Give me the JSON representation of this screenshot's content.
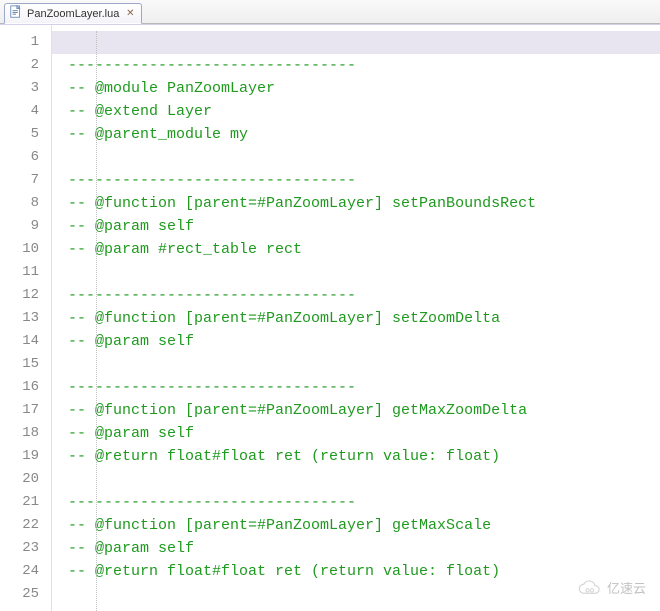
{
  "tab": {
    "filename": "PanZoomLayer.lua",
    "close_glyph": "✕"
  },
  "code": {
    "separator": "--------------------------------",
    "lines": [
      "",
      "--------------------------------",
      "-- @module PanZoomLayer",
      "-- @extend Layer",
      "-- @parent_module my",
      "",
      "--------------------------------",
      "-- @function [parent=#PanZoomLayer] setPanBoundsRect ",
      "-- @param self",
      "-- @param #rect_table rect",
      "        ",
      "--------------------------------",
      "-- @function [parent=#PanZoomLayer] setZoomDelta ",
      "-- @param self",
      "",
      "--------------------------------",
      "-- @function [parent=#PanZoomLayer] getMaxZoomDelta ",
      "-- @param self",
      "-- @return float#float ret (return value: float)",
      "        ",
      "--------------------------------",
      "-- @function [parent=#PanZoomLayer] getMaxScale ",
      "-- @param self",
      "-- @return float#float ret (return value: float)",
      "        "
    ]
  },
  "chart_data": {
    "type": "table",
    "title": "Lua source file PanZoomLayer.lua (LDoc comments)",
    "module": "PanZoomLayer",
    "extends": "Layer",
    "parent_module": "my",
    "functions": [
      {
        "name": "setPanBoundsRect",
        "params": [
          "self",
          "#rect_table rect"
        ],
        "returns": null
      },
      {
        "name": "setZoomDelta",
        "params": [
          "self"
        ],
        "returns": null
      },
      {
        "name": "getMaxZoomDelta",
        "params": [
          "self"
        ],
        "returns": "float#float ret (return value: float)"
      },
      {
        "name": "getMaxScale",
        "params": [
          "self"
        ],
        "returns": "float#float ret (return value: float)"
      }
    ]
  },
  "watermark": {
    "text": "亿速云"
  }
}
